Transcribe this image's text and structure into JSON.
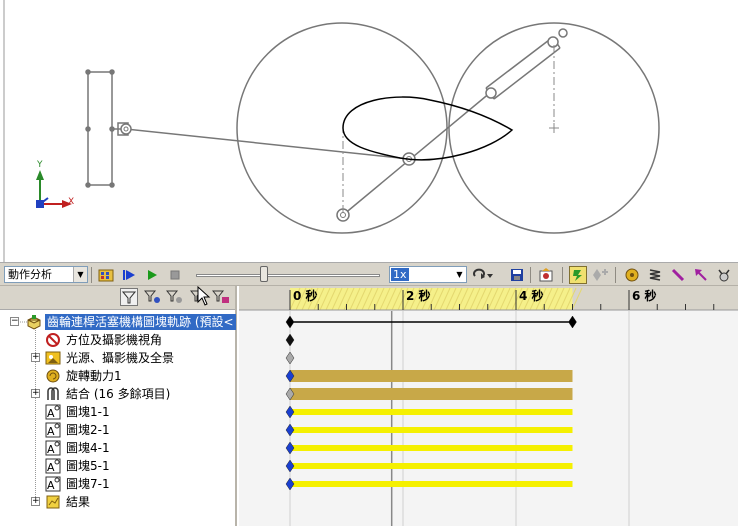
{
  "toolbar": {
    "study_type": "動作分析",
    "speed": "1x",
    "slider_position": 0.37
  },
  "tree": {
    "root": "齒輪連桿活塞機構圖塊軌跡 (預設<",
    "items": [
      {
        "label": "方位及攝影機視角",
        "icon": "no-entry-icon",
        "expandable": false
      },
      {
        "label": "光源、攝影機及全景",
        "icon": "lights-icon",
        "expandable": true
      },
      {
        "label": "旋轉動力1",
        "icon": "motor-icon",
        "expandable": false
      },
      {
        "label": "結合 (16 多餘項目)",
        "icon": "mates-icon",
        "expandable": true
      },
      {
        "label": "圖塊1-1",
        "icon": "block-icon",
        "expandable": false
      },
      {
        "label": "圖塊2-1",
        "icon": "block-icon",
        "expandable": false
      },
      {
        "label": "圖塊4-1",
        "icon": "block-icon",
        "expandable": false
      },
      {
        "label": "圖塊5-1",
        "icon": "block-icon",
        "expandable": false
      },
      {
        "label": "圖塊7-1",
        "icon": "block-icon",
        "expandable": false
      },
      {
        "label": "結果",
        "icon": "results-icon",
        "expandable": true
      }
    ]
  },
  "timeline": {
    "labels": [
      "0 秒",
      "2 秒",
      "4 秒",
      "6 秒"
    ],
    "duration_seconds": 5,
    "current_time_seconds": 1.8,
    "colors": {
      "ruler_highlight": "#f5f08a",
      "motor_bar": "#c8a848",
      "block_bar": "#f5f000",
      "key_blue": "#1a3fd0"
    }
  },
  "viewport": {
    "axis_y": "Y",
    "axis_x": "X"
  }
}
